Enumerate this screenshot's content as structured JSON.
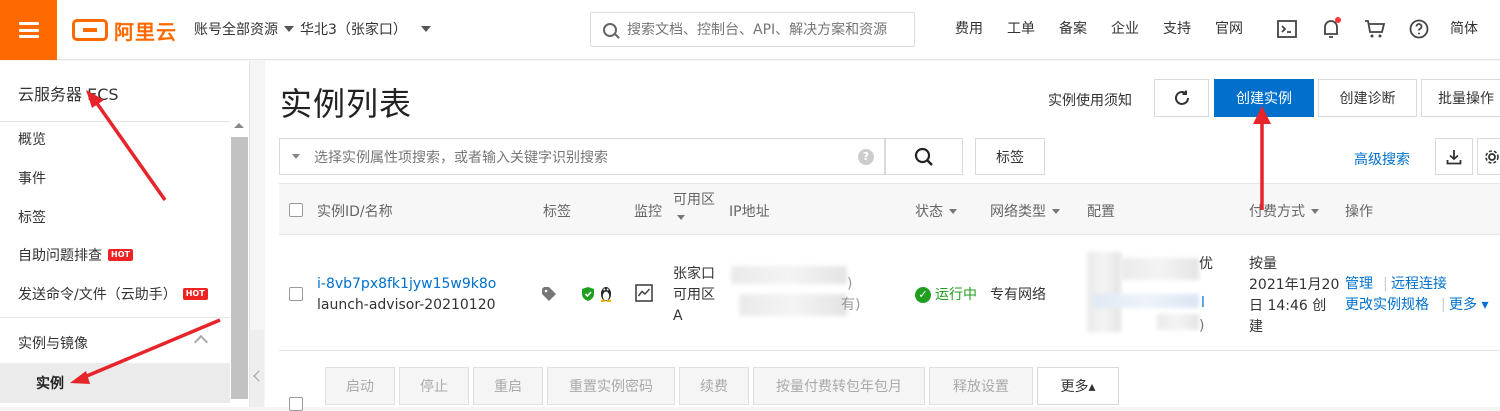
{
  "topbar": {
    "logo_text": "阿里云",
    "scope": "账号全部资源",
    "region": "华北3（张家口）",
    "search_placeholder": "搜索文档、控制台、API、解决方案和资源",
    "links": [
      "费用",
      "工单",
      "备案",
      "企业",
      "支持",
      "官网"
    ],
    "icons": [
      "terminal-icon",
      "bell-icon",
      "cart-icon",
      "help-icon"
    ],
    "lang": "简体",
    "accent_color": "#ff6a00"
  },
  "sidebar": {
    "title": "云服务器 ECS",
    "items": [
      {
        "label": "概览",
        "hot": ""
      },
      {
        "label": "事件",
        "hot": ""
      },
      {
        "label": "标签",
        "hot": ""
      },
      {
        "label": "自助问题排查",
        "hot": "HOT"
      },
      {
        "label": "发送命令/文件（云助手）",
        "hot": "HOT"
      }
    ],
    "group": "实例与镜像",
    "active_item": "实例"
  },
  "main": {
    "title": "实例列表",
    "notice": "实例使用须知",
    "buttons": {
      "create": "创建实例",
      "diagnose": "创建诊断",
      "batch": "批量操作"
    },
    "filter_placeholder": "选择实例属性项搜索，或者输入关键字识别搜索",
    "help_glyph": "?",
    "tag_button": "标签",
    "advanced_search": "高级搜索",
    "primary_color": "#0070cc",
    "columns": {
      "id": "实例ID/名称",
      "tag": "标签",
      "monitor": "监控",
      "zone": "可用区",
      "ip": "IP地址",
      "status": "状态",
      "network": "网络类型",
      "config": "配置",
      "billing": "付费方式",
      "ops": "操作"
    },
    "row": {
      "id": "i-8vb7px8fk1jyw15w9k8o",
      "name": "launch-advisor-20210120",
      "zone_line1": "张家口",
      "zone_line2": "可用区",
      "zone_line3": "A",
      "ip_fragment1": ")",
      "ip_fragment2": "有)",
      "status": "运行中",
      "status_color": "#1f9e1f",
      "network": "专有网络",
      "config_fragment1": "优",
      "config_fragment2": "l",
      "config_fragment3": ")",
      "billing_line1": "按量",
      "billing_line2": "2021年1月20",
      "billing_line3": "日 14:46 创",
      "billing_line4": "建",
      "op_manage": "管理",
      "op_remote": "远程连接",
      "op_resize": "更改实例规格",
      "op_more": "更多"
    },
    "action_bar": [
      "启动",
      "停止",
      "重启",
      "重置实例密码",
      "续费",
      "按量付费转包年包月",
      "释放设置"
    ],
    "action_more": "更多▴"
  }
}
